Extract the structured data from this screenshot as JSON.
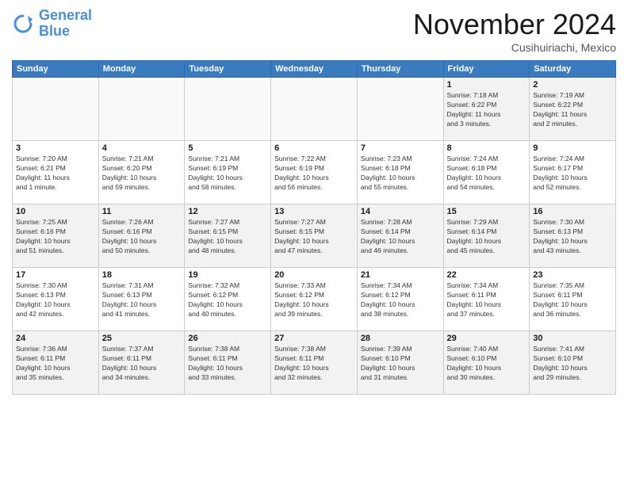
{
  "logo": {
    "text1": "General",
    "text2": "Blue"
  },
  "title": "November 2024",
  "location": "Cusihuiriachi, Mexico",
  "weekdays": [
    "Sunday",
    "Monday",
    "Tuesday",
    "Wednesday",
    "Thursday",
    "Friday",
    "Saturday"
  ],
  "weeks": [
    [
      {
        "day": "",
        "info": "",
        "empty": true
      },
      {
        "day": "",
        "info": "",
        "empty": true
      },
      {
        "day": "",
        "info": "",
        "empty": true
      },
      {
        "day": "",
        "info": "",
        "empty": true
      },
      {
        "day": "",
        "info": "",
        "empty": true
      },
      {
        "day": "1",
        "info": "Sunrise: 7:18 AM\nSunset: 6:22 PM\nDaylight: 11 hours\nand 3 minutes."
      },
      {
        "day": "2",
        "info": "Sunrise: 7:19 AM\nSunset: 6:22 PM\nDaylight: 11 hours\nand 2 minutes."
      }
    ],
    [
      {
        "day": "3",
        "info": "Sunrise: 7:20 AM\nSunset: 6:21 PM\nDaylight: 11 hours\nand 1 minute."
      },
      {
        "day": "4",
        "info": "Sunrise: 7:21 AM\nSunset: 6:20 PM\nDaylight: 10 hours\nand 59 minutes."
      },
      {
        "day": "5",
        "info": "Sunrise: 7:21 AM\nSunset: 6:19 PM\nDaylight: 10 hours\nand 58 minutes."
      },
      {
        "day": "6",
        "info": "Sunrise: 7:22 AM\nSunset: 6:19 PM\nDaylight: 10 hours\nand 56 minutes."
      },
      {
        "day": "7",
        "info": "Sunrise: 7:23 AM\nSunset: 6:18 PM\nDaylight: 10 hours\nand 55 minutes."
      },
      {
        "day": "8",
        "info": "Sunrise: 7:24 AM\nSunset: 6:18 PM\nDaylight: 10 hours\nand 54 minutes."
      },
      {
        "day": "9",
        "info": "Sunrise: 7:24 AM\nSunset: 6:17 PM\nDaylight: 10 hours\nand 52 minutes."
      }
    ],
    [
      {
        "day": "10",
        "info": "Sunrise: 7:25 AM\nSunset: 6:16 PM\nDaylight: 10 hours\nand 51 minutes."
      },
      {
        "day": "11",
        "info": "Sunrise: 7:26 AM\nSunset: 6:16 PM\nDaylight: 10 hours\nand 50 minutes."
      },
      {
        "day": "12",
        "info": "Sunrise: 7:27 AM\nSunset: 6:15 PM\nDaylight: 10 hours\nand 48 minutes."
      },
      {
        "day": "13",
        "info": "Sunrise: 7:27 AM\nSunset: 6:15 PM\nDaylight: 10 hours\nand 47 minutes."
      },
      {
        "day": "14",
        "info": "Sunrise: 7:28 AM\nSunset: 6:14 PM\nDaylight: 10 hours\nand 46 minutes."
      },
      {
        "day": "15",
        "info": "Sunrise: 7:29 AM\nSunset: 6:14 PM\nDaylight: 10 hours\nand 45 minutes."
      },
      {
        "day": "16",
        "info": "Sunrise: 7:30 AM\nSunset: 6:13 PM\nDaylight: 10 hours\nand 43 minutes."
      }
    ],
    [
      {
        "day": "17",
        "info": "Sunrise: 7:30 AM\nSunset: 6:13 PM\nDaylight: 10 hours\nand 42 minutes."
      },
      {
        "day": "18",
        "info": "Sunrise: 7:31 AM\nSunset: 6:13 PM\nDaylight: 10 hours\nand 41 minutes."
      },
      {
        "day": "19",
        "info": "Sunrise: 7:32 AM\nSunset: 6:12 PM\nDaylight: 10 hours\nand 40 minutes."
      },
      {
        "day": "20",
        "info": "Sunrise: 7:33 AM\nSunset: 6:12 PM\nDaylight: 10 hours\nand 39 minutes."
      },
      {
        "day": "21",
        "info": "Sunrise: 7:34 AM\nSunset: 6:12 PM\nDaylight: 10 hours\nand 38 minutes."
      },
      {
        "day": "22",
        "info": "Sunrise: 7:34 AM\nSunset: 6:11 PM\nDaylight: 10 hours\nand 37 minutes."
      },
      {
        "day": "23",
        "info": "Sunrise: 7:35 AM\nSunset: 6:11 PM\nDaylight: 10 hours\nand 36 minutes."
      }
    ],
    [
      {
        "day": "24",
        "info": "Sunrise: 7:36 AM\nSunset: 6:11 PM\nDaylight: 10 hours\nand 35 minutes."
      },
      {
        "day": "25",
        "info": "Sunrise: 7:37 AM\nSunset: 6:11 PM\nDaylight: 10 hours\nand 34 minutes."
      },
      {
        "day": "26",
        "info": "Sunrise: 7:38 AM\nSunset: 6:11 PM\nDaylight: 10 hours\nand 33 minutes."
      },
      {
        "day": "27",
        "info": "Sunrise: 7:38 AM\nSunset: 6:11 PM\nDaylight: 10 hours\nand 32 minutes."
      },
      {
        "day": "28",
        "info": "Sunrise: 7:39 AM\nSunset: 6:10 PM\nDaylight: 10 hours\nand 31 minutes."
      },
      {
        "day": "29",
        "info": "Sunrise: 7:40 AM\nSunset: 6:10 PM\nDaylight: 10 hours\nand 30 minutes."
      },
      {
        "day": "30",
        "info": "Sunrise: 7:41 AM\nSunset: 6:10 PM\nDaylight: 10 hours\nand 29 minutes."
      }
    ]
  ]
}
